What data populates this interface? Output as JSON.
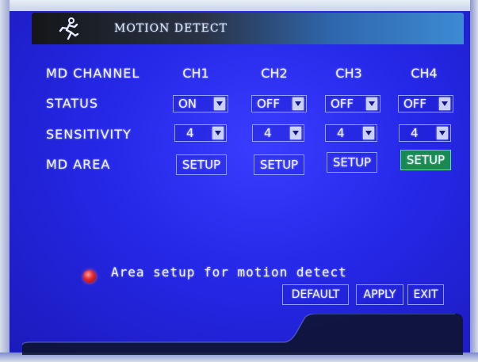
{
  "window": {
    "title": "MOTION DETECT",
    "icon": "running-man-icon"
  },
  "grid": {
    "row_labels": {
      "channel": "MD CHANNEL",
      "status": "STATUS",
      "sensitivity": "SENSITIVITY",
      "area": "MD AREA"
    },
    "channels": [
      {
        "name": "CH1",
        "status": "ON",
        "sensitivity": "4",
        "area_button": "SETUP"
      },
      {
        "name": "CH2",
        "status": "OFF",
        "sensitivity": "4",
        "area_button": "SETUP"
      },
      {
        "name": "CH3",
        "status": "OFF",
        "sensitivity": "4",
        "area_button": "SETUP"
      },
      {
        "name": "CH4",
        "status": "OFF",
        "sensitivity": "4",
        "area_button": "SETUP"
      }
    ],
    "selected_setup_channel": "CH4"
  },
  "hint": {
    "text": "Area setup for motion detect",
    "icon": "red-bulb-icon"
  },
  "buttons": {
    "default": "DEFAULT",
    "apply": "APPLY",
    "exit": "EXIT"
  },
  "colors": {
    "screen_blue": "#2527e6",
    "highlight_green": "#178a52",
    "bulb_red": "#e2262a",
    "title_dark": "#141618"
  }
}
